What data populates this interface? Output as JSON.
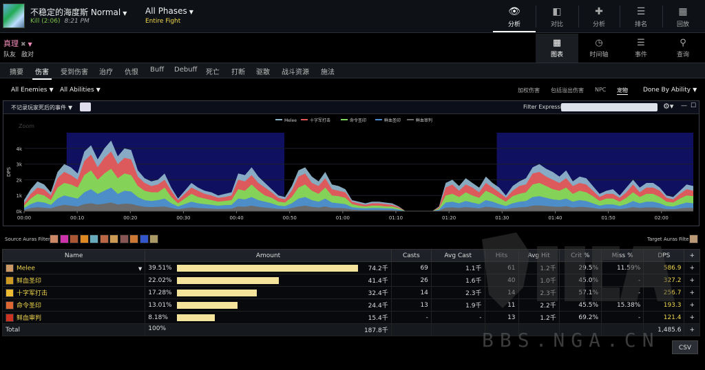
{
  "header": {
    "boss_name": "不稳定的海度斯 Normal",
    "kill_text": "Kill (2:06)",
    "time": "8:21 PM",
    "phases": "All Phases",
    "fight": "Entire Fight",
    "nav": [
      {
        "label": "分析",
        "icon": "eye-icon"
      },
      {
        "label": "对比",
        "icon": "compare-icon"
      },
      {
        "label": "分析",
        "icon": "puzzle-icon"
      },
      {
        "label": "排名",
        "icon": "list-icon"
      },
      {
        "label": "回放",
        "icon": "replay-icon"
      }
    ]
  },
  "player": {
    "name": "真理",
    "remove": "✖",
    "team_friend": "队友",
    "team_enemy": "敌对"
  },
  "views": [
    {
      "label": "图表",
      "icon": "grid-icon"
    },
    {
      "label": "时间轴",
      "icon": "clock-icon"
    },
    {
      "label": "事件",
      "icon": "list-icon"
    },
    {
      "label": "查询",
      "icon": "pin-icon"
    }
  ],
  "tabs": [
    "摘要",
    "伤害",
    "受到伤害",
    "治疗",
    "仇恨",
    "Buff",
    "Debuff",
    "死亡",
    "打断",
    "驱散",
    "战斗资源",
    "施法"
  ],
  "active_tab": "伤害",
  "filters": {
    "enemies": "All Enemies",
    "abilities": "All Abilities",
    "options": [
      "加权伤害",
      "包括溢出伤害",
      "NPC",
      "宠物"
    ],
    "done_by": "Done By Ability"
  },
  "chart_head": {
    "deaths_label": "不记录玩家死后的事件",
    "filter_label": "Filter Expression:",
    "filter_value": "",
    "gear_icon": "gear-icon"
  },
  "chart_data": {
    "type": "area",
    "ylabel": "DPS",
    "zoom_label": "Zoom",
    "y_ticks": [
      "0k",
      "1k",
      "2k",
      "3k",
      "4k"
    ],
    "ylim": [
      0,
      5000
    ],
    "x_ticks": [
      "00:00",
      "00:10",
      "00:20",
      "00:30",
      "00:40",
      "00:50",
      "01:00",
      "01:10",
      "01:20",
      "01:30",
      "01:40",
      "01:50",
      "02:00"
    ],
    "xlim_seconds": [
      0,
      126
    ],
    "highlight_ranges": [
      [
        8,
        49
      ],
      [
        89,
        126
      ]
    ],
    "series": [
      {
        "name": "Melee",
        "color": "#8fb3c9"
      },
      {
        "name": "十字军打击",
        "color": "#e05555"
      },
      {
        "name": "命令圣印",
        "color": "#7ed957"
      },
      {
        "name": "鲜血圣印",
        "color": "#4a8ad0"
      },
      {
        "name": "鲜血审判",
        "color": "#6b6b6b"
      }
    ],
    "stacked_top": [
      700,
      1400,
      1900,
      1700,
      1200,
      2500,
      3000,
      2800,
      2400,
      3800,
      4200,
      3300,
      4000,
      4500,
      3500,
      4000,
      3900,
      2600,
      2100,
      1900,
      2000,
      2400,
      1500,
      800,
      1300,
      1800,
      1500,
      1300,
      1200,
      1000,
      1100,
      1200,
      2400,
      2300,
      2800,
      2200,
      1800,
      1400,
      1000,
      900,
      1600,
      2600,
      2800,
      2200,
      1900,
      2500,
      1700,
      1600,
      1400,
      700,
      600,
      500,
      600,
      600,
      550,
      500,
      300,
      0,
      0,
      0,
      0,
      0,
      300,
      1800,
      2000,
      1600,
      2100,
      1800,
      1500,
      2200,
      1800,
      1500,
      1000,
      1600,
      1900,
      2100,
      2800,
      3000,
      2700,
      2500,
      2200,
      2600,
      1900,
      2200,
      2100,
      1600,
      1100,
      1300,
      1400,
      1000,
      1500,
      2000,
      1500,
      1800,
      1800,
      1500,
      1000,
      900,
      1300,
      1700,
      1600
    ],
    "bands": [
      [
        500,
        1100,
        1500,
        1400,
        1000,
        2100,
        2500,
        2300,
        2000,
        3200,
        3600,
        2800,
        3400,
        3800,
        3000,
        3400,
        3300,
        2200,
        1800,
        1600,
        1700,
        2000,
        1300,
        700,
        1100,
        1500,
        1300,
        1100,
        1000,
        850,
        900,
        1000,
        2000,
        1900,
        2300,
        1800,
        1500,
        1200,
        850,
        750,
        1300,
        2200,
        2400,
        1800,
        1600,
        2100,
        1400,
        1300,
        1200,
        600,
        500,
        400,
        500,
        500,
        450,
        400,
        250,
        0,
        0,
        0,
        0,
        0,
        250,
        1500,
        1700,
        1300,
        1700,
        1500,
        1200,
        1800,
        1500,
        1200,
        850,
        1300,
        1600,
        1700,
        2400,
        2500,
        2200,
        2000,
        1800,
        2100,
        1600,
        1800,
        1700,
        1300,
        900,
        1100,
        1100,
        850,
        1200,
        1700,
        1200,
        1500,
        1500,
        1300,
        850,
        750,
        1100,
        1400,
        1300
      ],
      [
        350,
        800,
        1100,
        1000,
        700,
        1500,
        1800,
        1700,
        1500,
        2300,
        2600,
        2000,
        2400,
        2700,
        2100,
        2400,
        2300,
        1600,
        1300,
        1200,
        1200,
        1500,
        900,
        500,
        800,
        1100,
        900,
        800,
        700,
        600,
        650,
        700,
        1400,
        1300,
        1700,
        1300,
        1000,
        850,
        600,
        550,
        900,
        1500,
        1700,
        1300,
        1100,
        1500,
        1000,
        950,
        850,
        450,
        350,
        300,
        350,
        350,
        300,
        300,
        180,
        0,
        0,
        0,
        0,
        0,
        180,
        1000,
        1100,
        900,
        1200,
        1000,
        850,
        1300,
        1100,
        850,
        600,
        950,
        1100,
        1200,
        1700,
        1800,
        1600,
        1400,
        1300,
        1500,
        1100,
        1300,
        1200,
        950,
        650,
        800,
        800,
        600,
        850,
        1200,
        900,
        1100,
        1100,
        900,
        600,
        550,
        800,
        1000,
        950
      ],
      [
        200,
        450,
        600,
        550,
        400,
        800,
        1000,
        900,
        800,
        1200,
        1400,
        1100,
        1300,
        1500,
        1100,
        1300,
        1250,
        900,
        700,
        650,
        700,
        800,
        500,
        300,
        450,
        600,
        500,
        450,
        400,
        350,
        380,
        400,
        800,
        750,
        900,
        700,
        600,
        500,
        350,
        320,
        500,
        800,
        900,
        700,
        600,
        800,
        550,
        500,
        450,
        250,
        200,
        180,
        200,
        200,
        180,
        170,
        100,
        0,
        0,
        0,
        0,
        0,
        100,
        550,
        600,
        500,
        650,
        550,
        450,
        700,
        600,
        450,
        330,
        500,
        600,
        650,
        900,
        950,
        850,
        750,
        700,
        800,
        600,
        700,
        650,
        500,
        350,
        430,
        430,
        330,
        450,
        650,
        500,
        600,
        600,
        500,
        330,
        300,
        430,
        550,
        500
      ],
      [
        80,
        200,
        250,
        220,
        180,
        320,
        400,
        350,
        300,
        450,
        500,
        420,
        480,
        550,
        420,
        480,
        460,
        350,
        280,
        260,
        270,
        300,
        200,
        120,
        180,
        240,
        200,
        180,
        160,
        140,
        150,
        160,
        300,
        280,
        350,
        270,
        230,
        190,
        140,
        130,
        200,
        300,
        350,
        270,
        230,
        300,
        210,
        200,
        180,
        100,
        80,
        70,
        80,
        80,
        70,
        70,
        40,
        0,
        0,
        0,
        0,
        0,
        40,
        220,
        240,
        200,
        260,
        220,
        180,
        280,
        240,
        180,
        130,
        200,
        240,
        260,
        350,
        370,
        330,
        290,
        270,
        310,
        230,
        270,
        250,
        200,
        140,
        170,
        170,
        130,
        180,
        260,
        200,
        240,
        240,
        200,
        130,
        120,
        170,
        220,
        200
      ]
    ]
  },
  "auras": {
    "source_label": "Source Auras Filter:",
    "target_label": "Target Auras Filter:",
    "source_icons": [
      "aura-1-icon",
      "aura-2-icon",
      "aura-3-icon",
      "aura-4-icon",
      "aura-5-icon",
      "aura-6-icon",
      "aura-7-icon",
      "aura-8-icon",
      "aura-9-icon",
      "aura-10-icon",
      "aura-11-icon"
    ],
    "source_colors": [
      "#c86",
      "#c3a",
      "#a53",
      "#d82",
      "#6ab",
      "#b64",
      "#c95",
      "#855",
      "#c73",
      "#35c",
      "#a96"
    ]
  },
  "table": {
    "headers": [
      "Name",
      "Amount",
      "Casts",
      "Avg Cast",
      "Hits",
      "Avg Hit",
      "Crit %",
      "Miss %",
      "DPS",
      "+"
    ],
    "rows": [
      {
        "name": "Melee",
        "pct": "39.51%",
        "frac": 0.9951,
        "amount": "74.2千",
        "casts": "69",
        "avg_cast": "1.1千",
        "hits": "61",
        "avg_hit": "1.2千",
        "crit": "29.5%",
        "miss": "11.59%",
        "dps": "586.9",
        "plus": "+",
        "icon_color": "#c96"
      },
      {
        "name": "鲜血圣印",
        "pct": "22.02%",
        "frac": 0.557,
        "amount": "41.4千",
        "casts": "26",
        "avg_cast": "1.6千",
        "hits": "40",
        "avg_hit": "1.0千",
        "crit": "45.0%",
        "miss": "-",
        "dps": "327.2",
        "plus": "+",
        "icon_color": "#c92"
      },
      {
        "name": "十字军打击",
        "pct": "17.28%",
        "frac": 0.437,
        "amount": "32.4千",
        "casts": "14",
        "avg_cast": "2.3千",
        "hits": "14",
        "avg_hit": "2.3千",
        "crit": "57.1%",
        "miss": "-",
        "dps": "256.7",
        "plus": "+",
        "icon_color": "#eb3"
      },
      {
        "name": "命令圣印",
        "pct": "13.01%",
        "frac": 0.33,
        "amount": "24.4千",
        "casts": "13",
        "avg_cast": "1.9千",
        "hits": "11",
        "avg_hit": "2.2千",
        "crit": "45.5%",
        "miss": "15.38%",
        "dps": "193.3",
        "plus": "+",
        "icon_color": "#d63"
      },
      {
        "name": "鲜血审判",
        "pct": "8.18%",
        "frac": 0.207,
        "amount": "15.4千",
        "casts": "-",
        "avg_cast": "-",
        "hits": "13",
        "avg_hit": "1.2千",
        "crit": "69.2%",
        "miss": "-",
        "dps": "121.4",
        "plus": "+",
        "icon_color": "#c32"
      }
    ],
    "total": {
      "name": "Total",
      "pct": "100%",
      "amount": "187.8千",
      "dps": "1,485.6",
      "plus": "+"
    }
  },
  "csv_label": "CSV",
  "watermark": "BBS.NGA.CN"
}
